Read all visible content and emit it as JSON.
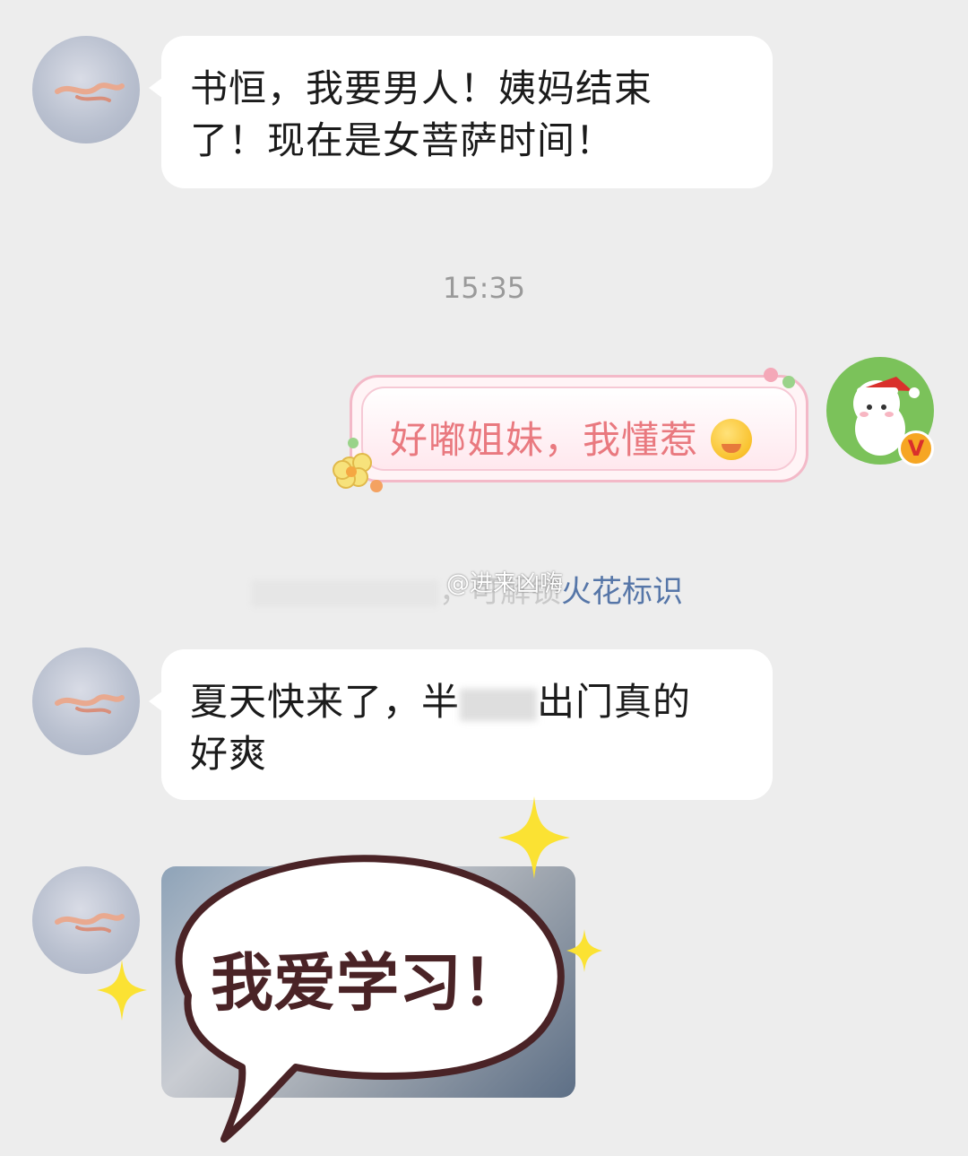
{
  "messages": [
    {
      "sender": "contact",
      "text_line1": "书恒，我要男人！姨妈结束",
      "text_line2": "了！现在是女菩萨时间！"
    },
    {
      "timestamp": "15:35"
    },
    {
      "sender": "me",
      "text": "好嘟姐妹，我懂惹",
      "emoji": "praying-blush-emoji"
    },
    {
      "system_link": "火花标识",
      "system_partial": "，可解锁",
      "watermark": "@进来凶嗨"
    },
    {
      "sender": "contact",
      "text_line1": "夏天快来了，半",
      "text_line1b": "出门真的",
      "text_line2": "好爽"
    },
    {
      "sender": "contact",
      "sticker_text": "我爱学习！"
    }
  ],
  "colors": {
    "background": "#ededed",
    "bubble_left": "#ffffff",
    "pink_text": "#e9797f",
    "system_link": "#5676a8",
    "sticker_outline": "#4a2326"
  },
  "icons": {
    "vip_badge": "V"
  }
}
